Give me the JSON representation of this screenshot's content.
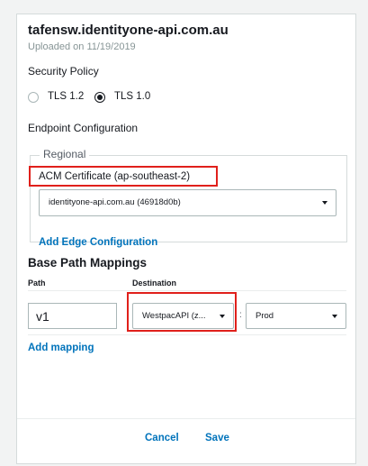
{
  "header": {
    "title": "tafensw.identityone-api.com.au",
    "uploaded": "Uploaded on 11/19/2019"
  },
  "security_policy": {
    "label": "Security Policy",
    "options": [
      {
        "label": "TLS 1.2",
        "selected": false
      },
      {
        "label": "TLS 1.0",
        "selected": true
      }
    ]
  },
  "endpoint": {
    "label": "Endpoint Configuration",
    "legend": "Regional",
    "acm_label": "ACM Certificate (ap-southeast-2)",
    "certificate_value": "identityone-api.com.au (46918d0b)",
    "add_edge_label": "Add Edge Configuration"
  },
  "mappings": {
    "title": "Base Path Mappings",
    "col_path": "Path",
    "col_destination": "Destination",
    "row": {
      "path": "v1",
      "destination": "WestpacAPI (z...",
      "separator": ":",
      "stage": "Prod"
    },
    "add_mapping_label": "Add mapping"
  },
  "footer": {
    "cancel_label": "Cancel",
    "save_label": "Save"
  },
  "colors": {
    "link": "#0073bb",
    "highlight": "#e0201b"
  }
}
